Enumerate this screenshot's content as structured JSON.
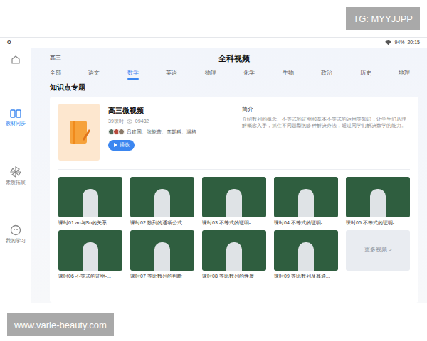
{
  "watermarks": {
    "top": "TG: MYYJJPP",
    "bottom": "www.varie-beauty.com"
  },
  "status_bar": {
    "left": "O",
    "battery": "94%",
    "time": "20:15"
  },
  "sidebar": {
    "items": [
      {
        "label": "教材同步",
        "selected": true
      },
      {
        "label": "素质拓展",
        "selected": false
      },
      {
        "label": "我的学习",
        "selected": false
      }
    ]
  },
  "header": {
    "grade": "高三",
    "title": "全科视频"
  },
  "tabs": [
    {
      "label": "全部",
      "selected": false
    },
    {
      "label": "语文",
      "selected": false
    },
    {
      "label": "数学",
      "selected": true
    },
    {
      "label": "英语",
      "selected": false
    },
    {
      "label": "物理",
      "selected": false
    },
    {
      "label": "化学",
      "selected": false
    },
    {
      "label": "生物",
      "selected": false
    },
    {
      "label": "政治",
      "selected": false
    },
    {
      "label": "历史",
      "selected": false
    },
    {
      "label": "地理",
      "selected": false
    }
  ],
  "section_title": "知识点专题",
  "course": {
    "title": "高三微视频",
    "lessons": "39课时",
    "views": "09482",
    "teachers": "吕建国、张晓蕾、李朝科、温格",
    "play_button": "播放",
    "intro_label": "简介",
    "intro": "介绍数列的概念、不等式的证明和基本不等式的运用等知识，让学生们从理解概念入手，抓住不同题型的多种解决办法，通过同学们解决数学的能力。"
  },
  "videos": [
    {
      "label": "课时01 an与Sn的关系"
    },
    {
      "label": "课时02 数列的通项公式"
    },
    {
      "label": "课时03 不等式的证明-..."
    },
    {
      "label": "课时04 不等式的证明-..."
    },
    {
      "label": "课时05 不等式的证明-..."
    },
    {
      "label": "课时06 不等式的证明-..."
    },
    {
      "label": "课时07 等比数列的判断"
    },
    {
      "label": "课时08 等比数列的性质"
    },
    {
      "label": "课时09 等比数列及其通..."
    }
  ],
  "more": "更多视频 >"
}
